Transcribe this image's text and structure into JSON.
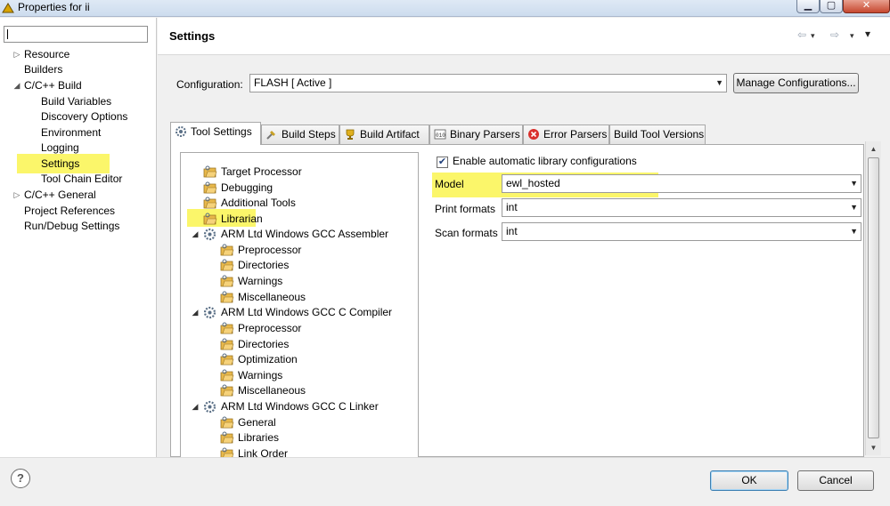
{
  "window": {
    "title": "Properties for ii"
  },
  "sidebar": {
    "filter_value": "",
    "items": [
      {
        "label": "Resource",
        "expander": "▷"
      },
      {
        "label": "Builders",
        "expander": ""
      },
      {
        "label": "C/C++ Build",
        "expander": "◢"
      },
      {
        "label": "Build Variables",
        "expander": ""
      },
      {
        "label": "Discovery Options",
        "expander": ""
      },
      {
        "label": "Environment",
        "expander": ""
      },
      {
        "label": "Logging",
        "expander": ""
      },
      {
        "label": "Settings",
        "expander": ""
      },
      {
        "label": "Tool Chain Editor",
        "expander": ""
      },
      {
        "label": "C/C++ General",
        "expander": "▷"
      },
      {
        "label": "Project References",
        "expander": ""
      },
      {
        "label": "Run/Debug Settings",
        "expander": ""
      }
    ]
  },
  "header": {
    "title": "Settings",
    "back": "⇦",
    "forward": "⇨",
    "menu": "▾"
  },
  "configuration": {
    "label": "Configuration:",
    "value": "FLASH  [ Active ]",
    "manage_button": "Manage Configurations..."
  },
  "tabs": [
    {
      "label": "Tool Settings"
    },
    {
      "label": "Build Steps"
    },
    {
      "label": "Build Artifact"
    },
    {
      "label": "Binary Parsers"
    },
    {
      "label": "Error Parsers"
    },
    {
      "label": "Build Tool Versions"
    }
  ],
  "tool_tree": [
    {
      "label": "Target Processor"
    },
    {
      "label": "Debugging"
    },
    {
      "label": "Additional Tools"
    },
    {
      "label": "Librarian"
    },
    {
      "label": "ARM Ltd Windows GCC Assembler",
      "expander": "◢"
    },
    {
      "label": "Preprocessor"
    },
    {
      "label": "Directories"
    },
    {
      "label": "Warnings"
    },
    {
      "label": "Miscellaneous"
    },
    {
      "label": "ARM Ltd Windows GCC C Compiler",
      "expander": "◢"
    },
    {
      "label": "Preprocessor"
    },
    {
      "label": "Directories"
    },
    {
      "label": "Optimization"
    },
    {
      "label": "Warnings"
    },
    {
      "label": "Miscellaneous"
    },
    {
      "label": "ARM Ltd Windows GCC C Linker",
      "expander": "◢"
    },
    {
      "label": "General"
    },
    {
      "label": "Libraries"
    },
    {
      "label": "Link Order"
    }
  ],
  "librarian": {
    "auto_config_label": "Enable automatic library configurations",
    "auto_config_checked": true,
    "fields": [
      {
        "label": "Model",
        "value": "ewl_hosted"
      },
      {
        "label": "Print formats",
        "value": "int"
      },
      {
        "label": "Scan formats",
        "value": "int"
      }
    ]
  },
  "footer": {
    "help": "?",
    "ok_label": "OK",
    "cancel_label": "Cancel"
  },
  "colors": {
    "highlight": "#fbf66a",
    "folder": "#e8b84a",
    "gear": "#5a6f86"
  }
}
